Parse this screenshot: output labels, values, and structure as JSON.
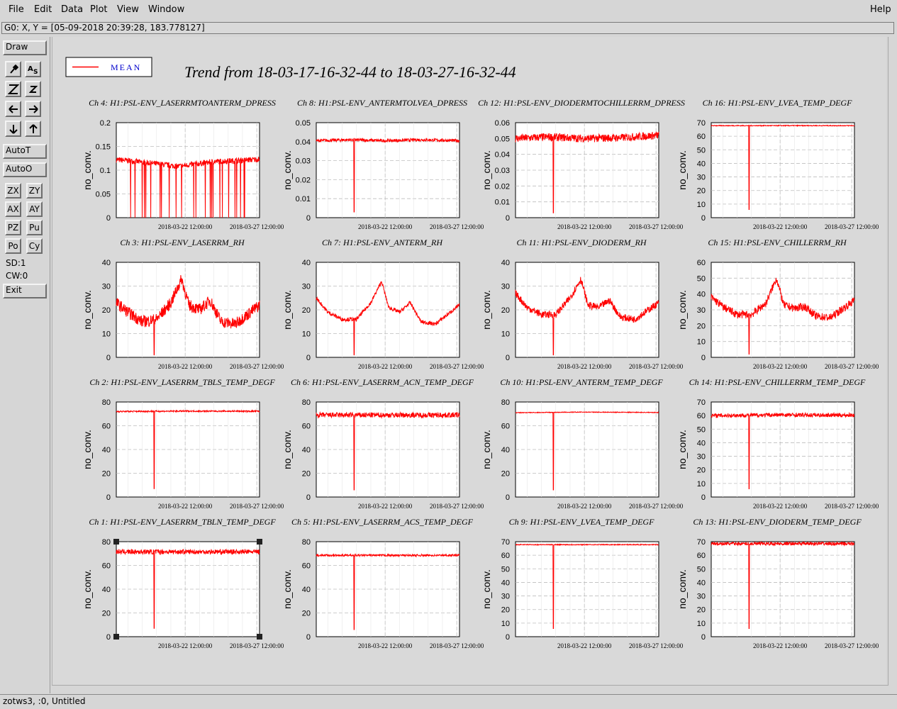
{
  "menu": {
    "items": [
      "File",
      "Edit",
      "Data",
      "Plot",
      "View",
      "Window"
    ],
    "help": "Help"
  },
  "coord_readout": "G0: X, Y = [05-09-2018 20:39:28, 183.778127]",
  "toolbar": {
    "draw": "Draw",
    "autot": "AutoT",
    "autoo": "AutoO",
    "zx": "ZX",
    "zy": "ZY",
    "ax": "AX",
    "ay": "AY",
    "pz": "PZ",
    "pu": "Pu",
    "po": "Po",
    "cy": "Cy",
    "sd": "SD:1",
    "cw": "CW:0",
    "exit": "Exit"
  },
  "legend": {
    "label": "MEAN"
  },
  "plot_title": "Trend from 18-03-17-16-32-44 to 18-03-27-16-32-44",
  "status": "zotws3, :0, Untitled",
  "colors": {
    "trace": "#ff0000",
    "grid": "#bdbdbd",
    "legend_text": "#0000cc"
  },
  "chart_data": [
    {
      "type": "line",
      "title": "Ch 4: H1:PSL-ENV_LASERRMTOANTERM_DPRESS",
      "ylabel": "no_conv.",
      "ylim": [
        0,
        0.2
      ],
      "yticks": [
        "0",
        "0.05",
        "0.1",
        "0.15",
        "0.2"
      ],
      "xticks": [
        "2018-03-22 12:00:00",
        "2018-03-27 12:00:00"
      ],
      "x": [
        "2018-03-17 16:32:44",
        "2018-03-18 12:00:00",
        "2018-03-20 00:00:00",
        "2018-03-22 00:00:00",
        "2018-03-24 12:00:00",
        "2018-03-26 00:00:00",
        "2018-03-27 16:32:44"
      ],
      "values": [
        0.122,
        0.12,
        0.115,
        0.108,
        0.118,
        0.12,
        0.123
      ],
      "noise": 0.006,
      "spike_x": "2018-03-19 00:00:00",
      "spike_min": 0.0,
      "dropouts": true
    },
    {
      "type": "line",
      "title": "Ch 8: H1:PSL-ENV_ANTERMTOLVEA_DPRESS",
      "ylabel": "no_conv.",
      "ylim": [
        0,
        0.05
      ],
      "yticks": [
        "0",
        "0.01",
        "0.02",
        "0.03",
        "0.04",
        "0.05"
      ],
      "xticks": [
        "2018-03-22 12:00:00",
        "2018-03-27 12:00:00"
      ],
      "x": [
        "2018-03-17 16:32:44",
        "2018-03-20 00:00:00",
        "2018-03-22 12:00:00",
        "2018-03-25 00:00:00",
        "2018-03-27 16:32:44"
      ],
      "values": [
        0.0405,
        0.041,
        0.0405,
        0.041,
        0.0405
      ],
      "noise": 0.0008,
      "spike_x": "2018-03-20 08:00:00",
      "spike_min": 0.003
    },
    {
      "type": "line",
      "title": "Ch 12: H1:PSL-ENV_DIODERMTOCHILLERRM_DPRESS",
      "ylabel": "no_conv.",
      "ylim": [
        0,
        0.06
      ],
      "yticks": [
        "0",
        "0.01",
        "0.02",
        "0.03",
        "0.04",
        "0.05",
        "0.06"
      ],
      "xticks": [
        "2018-03-22 12:00:00",
        "2018-03-27 12:00:00"
      ],
      "x": [
        "2018-03-17 16:32:44",
        "2018-03-20 00:00:00",
        "2018-03-22 12:00:00",
        "2018-03-25 00:00:00",
        "2018-03-27 16:32:44"
      ],
      "values": [
        0.05,
        0.051,
        0.05,
        0.0505,
        0.052
      ],
      "noise": 0.0025,
      "spike_x": "2018-03-20 08:00:00",
      "spike_min": 0.003
    },
    {
      "type": "line",
      "title": "Ch 16: H1:PSL-ENV_LVEA_TEMP_DEGF",
      "ylabel": "no_conv.",
      "ylim": [
        0,
        70
      ],
      "yticks": [
        "0",
        "10",
        "20",
        "30",
        "40",
        "50",
        "60",
        "70"
      ],
      "xticks": [
        "2018-03-22 12:00:00",
        "2018-03-27 12:00:00"
      ],
      "x": [
        "2018-03-17 16:32:44",
        "2018-03-22 12:00:00",
        "2018-03-27 16:32:44"
      ],
      "values": [
        67.8,
        67.8,
        67.8
      ],
      "noise": 0.3,
      "spike_x": "2018-03-20 08:00:00",
      "spike_min": 6
    },
    {
      "type": "line",
      "title": "Ch 3: H1:PSL-ENV_LASERRM_RH",
      "ylabel": "no_conv.",
      "ylim": [
        0,
        40
      ],
      "yticks": [
        "0",
        "10",
        "20",
        "30",
        "40"
      ],
      "xticks": [
        "2018-03-22 12:00:00",
        "2018-03-27 12:00:00"
      ],
      "x": [
        "2018-03-17 16:32:44",
        "2018-03-18 12:00:00",
        "2018-03-19 12:00:00",
        "2018-03-20 12:00:00",
        "2018-03-21 12:00:00",
        "2018-03-22 06:00:00",
        "2018-03-22 18:00:00",
        "2018-03-23 12:00:00",
        "2018-03-24 06:00:00",
        "2018-03-25 00:00:00",
        "2018-03-26 00:00:00",
        "2018-03-27 16:32:44"
      ],
      "values": [
        23,
        19,
        15,
        16,
        23,
        33,
        22,
        20,
        24,
        15,
        14,
        22
      ],
      "noise": 2.5,
      "spike_x": "2018-03-20 08:00:00",
      "spike_min": 1
    },
    {
      "type": "line",
      "title": "Ch 7: H1:PSL-ENV_ANTERM_RH",
      "ylabel": "no_conv.",
      "ylim": [
        0,
        40
      ],
      "yticks": [
        "0",
        "10",
        "20",
        "30",
        "40"
      ],
      "xticks": [
        "2018-03-22 12:00:00",
        "2018-03-27 12:00:00"
      ],
      "x": [
        "2018-03-17 16:32:44",
        "2018-03-18 12:00:00",
        "2018-03-19 12:00:00",
        "2018-03-20 12:00:00",
        "2018-03-21 12:00:00",
        "2018-03-22 06:00:00",
        "2018-03-22 18:00:00",
        "2018-03-23 12:00:00",
        "2018-03-24 06:00:00",
        "2018-03-25 00:00:00",
        "2018-03-26 00:00:00",
        "2018-03-27 16:32:44"
      ],
      "values": [
        25,
        19,
        16,
        16,
        23,
        32,
        21,
        19,
        23,
        15,
        14,
        22
      ],
      "noise": 0.8,
      "spike_x": "2018-03-20 08:00:00",
      "spike_min": 1
    },
    {
      "type": "line",
      "title": "Ch 11: H1:PSL-ENV_DIODERM_RH",
      "ylabel": "no_conv.",
      "ylim": [
        0,
        40
      ],
      "yticks": [
        "0",
        "10",
        "20",
        "30",
        "40"
      ],
      "xticks": [
        "2018-03-22 12:00:00",
        "2018-03-27 12:00:00"
      ],
      "x": [
        "2018-03-17 16:32:44",
        "2018-03-18 12:00:00",
        "2018-03-19 12:00:00",
        "2018-03-20 12:00:00",
        "2018-03-21 12:00:00",
        "2018-03-22 06:00:00",
        "2018-03-22 18:00:00",
        "2018-03-23 12:00:00",
        "2018-03-24 06:00:00",
        "2018-03-25 00:00:00",
        "2018-03-26 00:00:00",
        "2018-03-27 16:32:44"
      ],
      "values": [
        27,
        21,
        18,
        18,
        25,
        33,
        22,
        21,
        24,
        17,
        16,
        23
      ],
      "noise": 1.5,
      "spike_x": "2018-03-20 08:00:00",
      "spike_min": 1
    },
    {
      "type": "line",
      "title": "Ch 15: H1:PSL-ENV_CHILLERRM_RH",
      "ylabel": "no_conv.",
      "ylim": [
        0,
        60
      ],
      "yticks": [
        "0",
        "10",
        "20",
        "30",
        "40",
        "50",
        "60"
      ],
      "xticks": [
        "2018-03-22 12:00:00",
        "2018-03-27 12:00:00"
      ],
      "x": [
        "2018-03-17 16:32:44",
        "2018-03-18 12:00:00",
        "2018-03-19 12:00:00",
        "2018-03-20 12:00:00",
        "2018-03-21 12:00:00",
        "2018-03-22 06:00:00",
        "2018-03-22 18:00:00",
        "2018-03-23 12:00:00",
        "2018-03-24 06:00:00",
        "2018-03-25 00:00:00",
        "2018-03-26 00:00:00",
        "2018-03-27 16:32:44"
      ],
      "values": [
        38,
        32,
        27,
        27,
        34,
        50,
        33,
        31,
        32,
        26,
        25,
        36
      ],
      "noise": 2.5,
      "spike_x": "2018-03-20 08:00:00",
      "spike_min": 2
    },
    {
      "type": "line",
      "title": "Ch 2: H1:PSL-ENV_LASERRM_TBLS_TEMP_DEGF",
      "ylabel": "no_conv.",
      "ylim": [
        0,
        80
      ],
      "yticks": [
        "0",
        "20",
        "40",
        "60",
        "80"
      ],
      "xticks": [
        "2018-03-22 12:00:00",
        "2018-03-27 12:00:00"
      ],
      "x": [
        "2018-03-17 16:32:44",
        "2018-03-22 12:00:00",
        "2018-03-27 16:32:44"
      ],
      "values": [
        72,
        72.3,
        72.2
      ],
      "noise": 0.6,
      "spike_x": "2018-03-20 08:00:00",
      "spike_min": 7
    },
    {
      "type": "line",
      "title": "Ch 6: H1:PSL-ENV_LASERRM_ACN_TEMP_DEGF",
      "ylabel": "no_conv.",
      "ylim": [
        0,
        80
      ],
      "yticks": [
        "0",
        "20",
        "40",
        "60",
        "80"
      ],
      "xticks": [
        "2018-03-22 12:00:00",
        "2018-03-27 12:00:00"
      ],
      "x": [
        "2018-03-17 16:32:44",
        "2018-03-22 12:00:00",
        "2018-03-27 16:32:44"
      ],
      "values": [
        69,
        69,
        69
      ],
      "noise": 2.2,
      "spike_x": "2018-03-20 08:00:00",
      "spike_min": 6
    },
    {
      "type": "line",
      "title": "Ch 10: H1:PSL-ENV_ANTERM_TEMP_DEGF",
      "ylabel": "no_conv.",
      "ylim": [
        0,
        80
      ],
      "yticks": [
        "0",
        "20",
        "40",
        "60",
        "80"
      ],
      "xticks": [
        "2018-03-22 12:00:00",
        "2018-03-27 12:00:00"
      ],
      "x": [
        "2018-03-17 16:32:44",
        "2018-03-22 12:00:00",
        "2018-03-27 16:32:44"
      ],
      "values": [
        71,
        71.5,
        71.2
      ],
      "noise": 0.3,
      "spike_x": "2018-03-20 08:00:00",
      "spike_min": 6
    },
    {
      "type": "line",
      "title": "Ch 14: H1:PSL-ENV_CHILLERRM_TEMP_DEGF",
      "ylabel": "no_conv.",
      "ylim": [
        0,
        70
      ],
      "yticks": [
        "0",
        "10",
        "20",
        "30",
        "40",
        "50",
        "60",
        "70"
      ],
      "xticks": [
        "2018-03-22 12:00:00",
        "2018-03-27 12:00:00"
      ],
      "x": [
        "2018-03-17 16:32:44",
        "2018-03-22 12:00:00",
        "2018-03-27 16:32:44"
      ],
      "values": [
        60,
        60.5,
        60.3
      ],
      "noise": 1.5,
      "spike_x": "2018-03-20 08:00:00",
      "spike_min": 6
    },
    {
      "type": "line",
      "title": "Ch 1: H1:PSL-ENV_LASERRM_TBLN_TEMP_DEGF",
      "ylabel": "no_conv.",
      "ylim": [
        0,
        80
      ],
      "yticks": [
        "0",
        "20",
        "40",
        "60",
        "80"
      ],
      "xticks": [
        "2018-03-22 12:00:00",
        "2018-03-27 12:00:00"
      ],
      "x": [
        "2018-03-17 16:32:44",
        "2018-03-22 12:00:00",
        "2018-03-27 16:32:44"
      ],
      "values": [
        71.5,
        71.5,
        71.5
      ],
      "noise": 2,
      "spike_x": "2018-03-20 08:00:00",
      "spike_min": 7,
      "selected": true
    },
    {
      "type": "line",
      "title": "Ch 5: H1:PSL-ENV_LASERRM_ACS_TEMP_DEGF",
      "ylabel": "no_conv.",
      "ylim": [
        0,
        80
      ],
      "yticks": [
        "0",
        "20",
        "40",
        "60",
        "80"
      ],
      "xticks": [
        "2018-03-22 12:00:00",
        "2018-03-27 12:00:00"
      ],
      "x": [
        "2018-03-17 16:32:44",
        "2018-03-22 12:00:00",
        "2018-03-27 16:32:44"
      ],
      "values": [
        68.5,
        68.5,
        68.5
      ],
      "noise": 0.8,
      "spike_x": "2018-03-20 08:00:00",
      "spike_min": 6
    },
    {
      "type": "line",
      "title": "Ch 9: H1:PSL-ENV_LVEA_TEMP_DEGF",
      "ylabel": "no_conv.",
      "ylim": [
        0,
        70
      ],
      "yticks": [
        "0",
        "10",
        "20",
        "30",
        "40",
        "50",
        "60",
        "70"
      ],
      "xticks": [
        "2018-03-22 12:00:00",
        "2018-03-27 12:00:00"
      ],
      "x": [
        "2018-03-17 16:32:44",
        "2018-03-22 12:00:00",
        "2018-03-27 16:32:44"
      ],
      "values": [
        67.8,
        67.8,
        67.8
      ],
      "noise": 0.3,
      "spike_x": "2018-03-20 08:00:00",
      "spike_min": 6
    },
    {
      "type": "line",
      "title": "Ch 13: H1:PSL-ENV_DIODERM_TEMP_DEGF",
      "ylabel": "no_conv.",
      "ylim": [
        0,
        70
      ],
      "yticks": [
        "0",
        "10",
        "20",
        "30",
        "40",
        "50",
        "60",
        "70"
      ],
      "xticks": [
        "2018-03-22 12:00:00",
        "2018-03-27 12:00:00"
      ],
      "x": [
        "2018-03-17 16:32:44",
        "2018-03-22 12:00:00",
        "2018-03-27 16:32:44"
      ],
      "values": [
        68.5,
        68.5,
        68.5
      ],
      "noise": 1.2,
      "spike_x": "2018-03-20 08:00:00",
      "spike_min": 6
    }
  ]
}
